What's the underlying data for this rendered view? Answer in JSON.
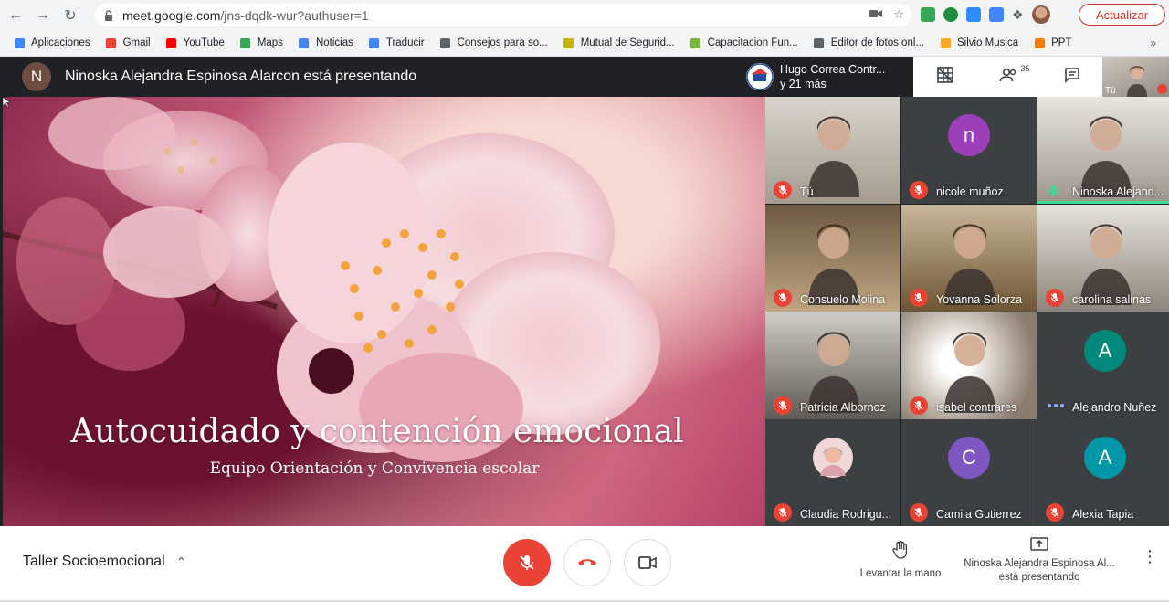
{
  "browser": {
    "url_host": "meet.google.com",
    "url_path": "/jns-dqdk-wur?authuser=1",
    "update_label": "Actualizar",
    "bookmarks": [
      {
        "label": "Aplicaciones",
        "icon": "apps-grid-icon",
        "color": "#4285f4"
      },
      {
        "label": "Gmail",
        "icon": "gmail-icon",
        "color": "#ea4335"
      },
      {
        "label": "YouTube",
        "icon": "youtube-icon",
        "color": "#ff0000"
      },
      {
        "label": "Maps",
        "icon": "maps-pin-icon",
        "color": "#34a853"
      },
      {
        "label": "Noticias",
        "icon": "news-icon",
        "color": "#4285f4"
      },
      {
        "label": "Traducir",
        "icon": "translate-icon",
        "color": "#4285f4"
      },
      {
        "label": "Consejos para so...",
        "icon": "globe-icon",
        "color": "#5f6368"
      },
      {
        "label": "Mutual de Segurid...",
        "icon": "mutual-icon",
        "color": "#c8b400"
      },
      {
        "label": "Capacitacion Fun...",
        "icon": "leaf-icon",
        "color": "#7cb342"
      },
      {
        "label": "Editor de fotos onl...",
        "icon": "photo-editor-icon",
        "color": "#5f6368"
      },
      {
        "label": "Silvio Musica",
        "icon": "headphones-icon",
        "color": "#f9a825"
      },
      {
        "label": "PPT",
        "icon": "ppt-icon",
        "color": "#f57c00"
      }
    ],
    "bookmarks_more": "»"
  },
  "meet": {
    "presenter": {
      "initial": "N",
      "text": "Ninoska Alejandra Espinosa Alarcon está presentando"
    },
    "chip": {
      "line1": "Hugo Correa Contr...",
      "line2": "y 21 más"
    },
    "participant_count": "35",
    "self_label": "Tú",
    "slide": {
      "title": "Autocuidado y contención emocional",
      "subtitle": "Equipo Orientación y Convivencia escolar"
    },
    "tiles": [
      {
        "name": "Tú",
        "type": "video",
        "mic": "muted"
      },
      {
        "name": "nicole muñoz",
        "type": "letter",
        "letter": "n",
        "color": "#9c3fb8",
        "mic": "muted"
      },
      {
        "name": "Ninoska Alejand...",
        "type": "video",
        "mic": "speaking"
      },
      {
        "name": "Consuelo Molina",
        "type": "video",
        "mic": "muted"
      },
      {
        "name": "Yovanna Solorza",
        "type": "video",
        "mic": "muted"
      },
      {
        "name": "carolina salinas",
        "type": "video",
        "mic": "muted"
      },
      {
        "name": "Patricia Albornoz",
        "type": "video",
        "mic": "muted"
      },
      {
        "name": "isabel contrares",
        "type": "video",
        "mic": "muted"
      },
      {
        "name": "Alejandro Nuñez",
        "type": "letter",
        "letter": "A",
        "color": "#00897b",
        "mic": "dots"
      },
      {
        "name": "Claudia Rodrigu...",
        "type": "photo",
        "mic": "muted"
      },
      {
        "name": "Camila Gutierrez",
        "type": "letter",
        "letter": "C",
        "color": "#7e57c2",
        "mic": "muted"
      },
      {
        "name": "Alexia Tapia",
        "type": "letter",
        "letter": "A",
        "color": "#0097a7",
        "mic": "muted"
      }
    ]
  },
  "bottom": {
    "meeting_name": "Taller Socioemocional",
    "raise_hand": "Levantar la mano",
    "present_line1": "Ninoska Alejandra Espinosa Al...",
    "present_line2": "está presentando"
  }
}
